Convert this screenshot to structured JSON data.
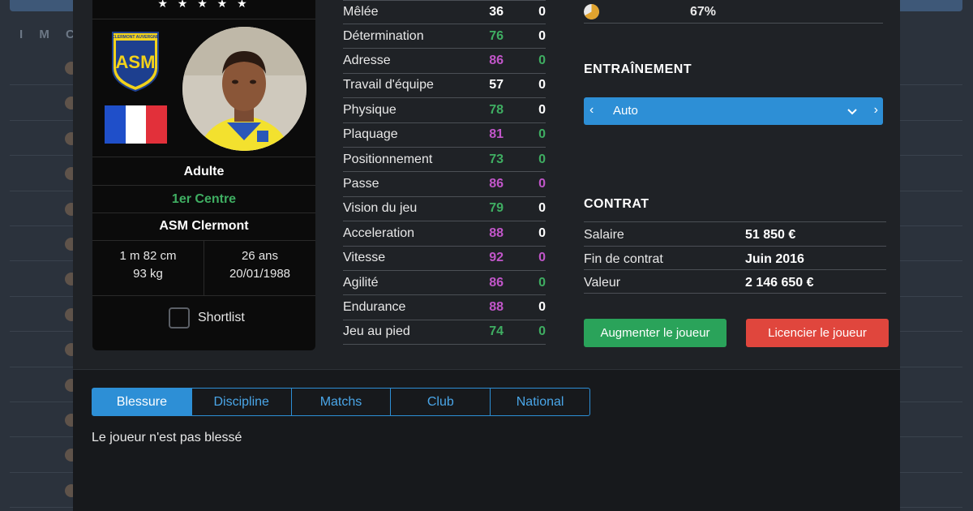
{
  "background": {
    "header_letters": [
      "I",
      "M",
      "CM"
    ],
    "row_count": 13
  },
  "player": {
    "stars": "★ ★ ★ ★ ★",
    "age_category": "Adulte",
    "position": "1er Centre",
    "club": "ASM Clermont",
    "height": "1 m 82  cm",
    "weight": "93 kg",
    "age": "26 ans",
    "birthdate": "20/01/1988",
    "shortlist_label": "Shortlist",
    "crest_text": "CLERMONT AUVERGNE",
    "crest_letters": "ASM"
  },
  "attributes": [
    {
      "name": "Mêlée",
      "value": "36",
      "color": "#ffffff",
      "delta": "0",
      "delta_color": "#ffffff"
    },
    {
      "name": "Détermination",
      "value": "76",
      "color": "#3fae62",
      "delta": "0",
      "delta_color": "#ffffff"
    },
    {
      "name": "Adresse",
      "value": "86",
      "color": "#c156c9",
      "delta": "0",
      "delta_color": "#3fae62"
    },
    {
      "name": "Travail d'équipe",
      "value": "57",
      "color": "#ffffff",
      "delta": "0",
      "delta_color": "#ffffff"
    },
    {
      "name": "Physique",
      "value": "78",
      "color": "#3fae62",
      "delta": "0",
      "delta_color": "#ffffff"
    },
    {
      "name": "Plaquage",
      "value": "81",
      "color": "#c156c9",
      "delta": "0",
      "delta_color": "#3fae62"
    },
    {
      "name": "Positionnement",
      "value": "73",
      "color": "#3fae62",
      "delta": "0",
      "delta_color": "#3fae62"
    },
    {
      "name": "Passe",
      "value": "86",
      "color": "#c156c9",
      "delta": "0",
      "delta_color": "#c156c9"
    },
    {
      "name": "Vision du jeu",
      "value": "79",
      "color": "#3fae62",
      "delta": "0",
      "delta_color": "#ffffff"
    },
    {
      "name": "Acceleration",
      "value": "88",
      "color": "#c156c9",
      "delta": "0",
      "delta_color": "#ffffff"
    },
    {
      "name": "Vitesse",
      "value": "92",
      "color": "#c156c9",
      "delta": "0",
      "delta_color": "#c156c9"
    },
    {
      "name": "Agilité",
      "value": "86",
      "color": "#c156c9",
      "delta": "0",
      "delta_color": "#3fae62"
    },
    {
      "name": "Endurance",
      "value": "88",
      "color": "#c156c9",
      "delta": "0",
      "delta_color": "#ffffff"
    },
    {
      "name": "Jeu au pied",
      "value": "74",
      "color": "#3fae62",
      "delta": "0",
      "delta_color": "#3fae62"
    }
  ],
  "morale": {
    "value": "67%",
    "fraction": 0.67
  },
  "training": {
    "title": "ENTRAÎNEMENT",
    "selected": "Auto"
  },
  "contract": {
    "title": "CONTRAT",
    "rows": [
      {
        "label": "Salaire",
        "value": "51 850 €"
      },
      {
        "label": "Fin de contrat",
        "value": "Juin 2016"
      },
      {
        "label": "Valeur",
        "value": "2 146 650 €"
      }
    ]
  },
  "actions": {
    "increase": "Augmenter le joueur",
    "fire": "Licencier le joueur"
  },
  "tabs": [
    {
      "label": "Blessure",
      "active": true
    },
    {
      "label": "Discipline",
      "active": false
    },
    {
      "label": "Matchs",
      "active": false
    },
    {
      "label": "Club",
      "active": false
    },
    {
      "label": "National",
      "active": false
    }
  ],
  "injury_text": "Le joueur n'est pas blessé",
  "colors": {
    "accent_blue": "#2d8fd6",
    "green": "#3fae62",
    "purple": "#c156c9",
    "red": "#e0463d"
  }
}
